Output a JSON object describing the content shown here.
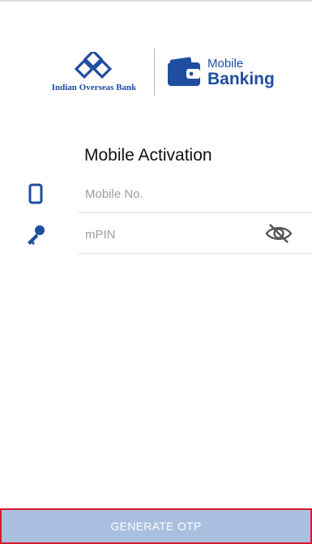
{
  "header": {
    "bank_name": "Indian Overseas Bank",
    "app_name_line1": "Mobile",
    "app_name_line2": "Banking"
  },
  "form": {
    "title": "Mobile Activation",
    "mobile_field": {
      "icon": "phone-icon",
      "placeholder": "Mobile No.",
      "value": ""
    },
    "mpin_field": {
      "icon": "key-icon",
      "placeholder": "mPIN",
      "value": "",
      "visibility_icon": "eye-off-icon"
    }
  },
  "footer": {
    "button_label": "GENERATE OTP"
  },
  "colors": {
    "brand_blue": "#1f4ea1",
    "button_disabled": "#a9bfe0",
    "highlight_border": "#d9182d"
  }
}
